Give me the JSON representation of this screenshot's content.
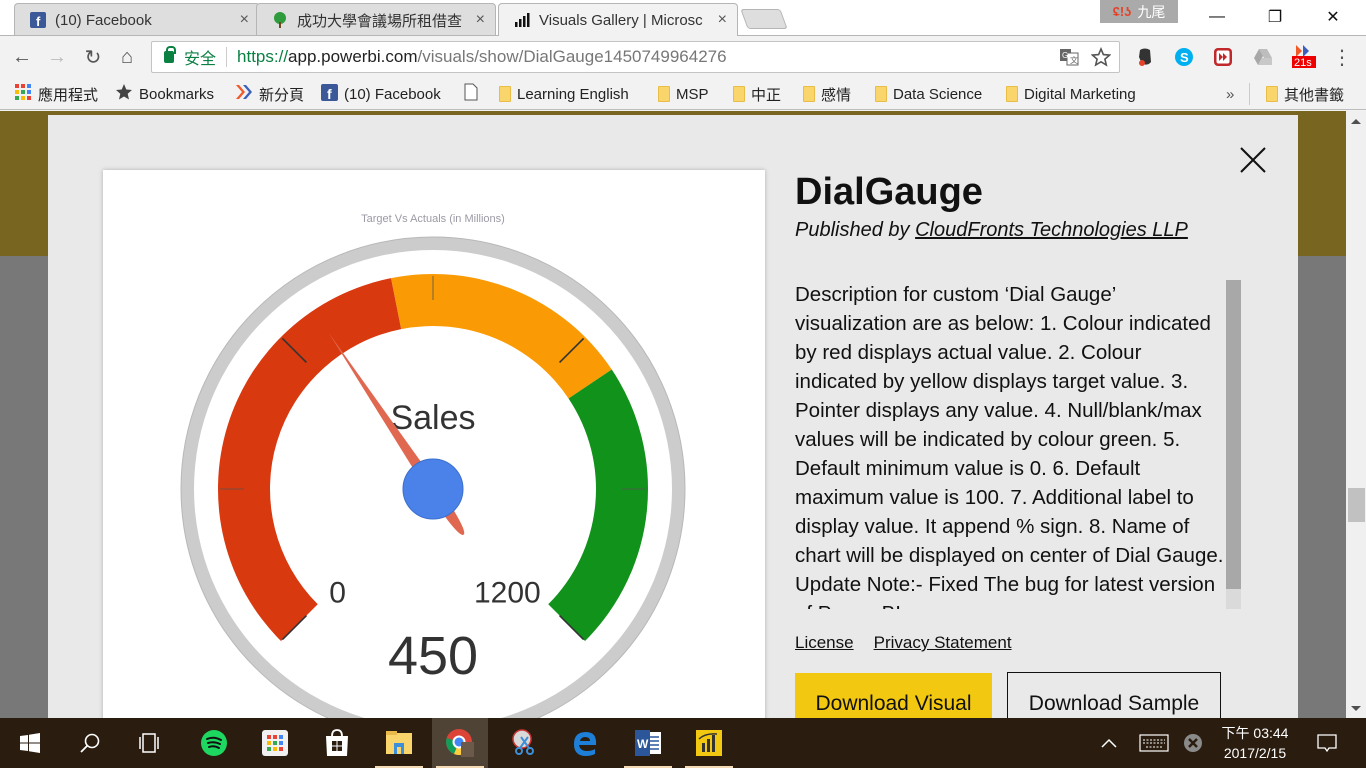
{
  "browser": {
    "tabs": [
      {
        "title": "(10) Facebook",
        "icon": "facebook-icon",
        "active": false
      },
      {
        "title": "成功大學會議場所租借查",
        "icon": "tree-icon",
        "active": false
      },
      {
        "title": "Visuals Gallery | Microsc",
        "icon": "powerbi-bars-icon",
        "active": true
      }
    ],
    "tab_close_glyph": "×",
    "profile_name": "九尾",
    "profile_sync_glyph": "ʢ!ʖ",
    "window_controls": {
      "minimize": "—",
      "restore": "❐",
      "close": "✕"
    },
    "nav": {
      "back": "←",
      "forward": "→",
      "reload": "↻",
      "home": "⌂"
    },
    "omnibox": {
      "secure_label": "安全",
      "url_scheme": "https://",
      "url_host": "app.powerbi.com",
      "url_path": "/visuals/show/DialGauge1450749964276"
    },
    "extensions": [
      {
        "name": "evernote-icon"
      },
      {
        "name": "skype-icon"
      },
      {
        "name": "video-speed-icon"
      },
      {
        "name": "google-drive-icon"
      },
      {
        "name": "timer-extension-icon",
        "badge": "21s"
      }
    ],
    "menu_glyph": "⋮",
    "bookmarks": [
      {
        "label": "應用程式",
        "icon": "apps-grid-icon"
      },
      {
        "label": "Bookmarks",
        "icon": "star-icon"
      },
      {
        "label": "新分頁",
        "icon": "double-chevron-icon"
      },
      {
        "label": "(10) Facebook",
        "icon": "facebook-icon"
      },
      {
        "label": "",
        "icon": "page-icon"
      },
      {
        "label": "Learning English",
        "icon": "folder-icon"
      },
      {
        "label": "MSP",
        "icon": "folder-icon"
      },
      {
        "label": "中正",
        "icon": "folder-icon"
      },
      {
        "label": "感情",
        "icon": "folder-icon"
      },
      {
        "label": "Data Science",
        "icon": "folder-icon"
      },
      {
        "label": "Digital Marketing",
        "icon": "folder-icon"
      }
    ],
    "bookmarks_overflow": "»",
    "other_bookmarks": "其他書籤"
  },
  "visual": {
    "title": "DialGauge",
    "published_by_label": "Published by",
    "publisher": "CloudFronts Technologies LLP",
    "description": "Description for custom ‘Dial Gauge’ visualization are as below: 1. Colour indicated by red displays actual value. 2. Colour indicated by yellow displays target value. 3. Pointer displays any value. 4. Null/blank/max values will be indicated by colour green. 5. Default minimum value is 0. 6. Default maximum value is 100. 7. Additional label to display value. It append % sign. 8. Name of chart will be displayed on center of Dial Gauge. Update Note:- Fixed The bug for latest version of Power BI",
    "description_scroll_fraction": 0.94,
    "links": [
      "License",
      "Privacy Statement"
    ],
    "download_visual": "Download Visual",
    "download_sample": "Download Sample",
    "close_glyph": "✕"
  },
  "chart_data": {
    "type": "gauge",
    "title": "Target Vs Actuals (in Millions)",
    "center_label": "Sales",
    "min": 0,
    "max": 1200,
    "min_label": "0",
    "max_label": "1200",
    "value": 450,
    "value_label": "450",
    "bands": [
      {
        "name": "actual",
        "from": 0,
        "to": 550,
        "color": "#d9390f"
      },
      {
        "name": "target",
        "from": 550,
        "to": 850,
        "color": "#fa9a04"
      },
      {
        "name": "max",
        "from": 850,
        "to": 1200,
        "color": "#10921b"
      }
    ],
    "major_ticks": [
      0,
      400,
      800,
      1200
    ],
    "minor_ticks": [
      200,
      600,
      1000
    ],
    "colors": {
      "ring": "#cccccc",
      "needle": "#e06850",
      "hub": "#4a82ea",
      "text": "#333333",
      "title": "#9a9aa5"
    }
  },
  "page": {
    "banner_color": "#786620",
    "overlay_color": "#787878",
    "accent_button": "#f2c811"
  },
  "taskbar": {
    "apps": [
      {
        "name": "start-icon"
      },
      {
        "name": "search-icon"
      },
      {
        "name": "task-view-icon"
      },
      {
        "name": "spotify-icon"
      },
      {
        "name": "app-launcher-icon"
      },
      {
        "name": "store-icon"
      },
      {
        "name": "file-explorer-icon"
      },
      {
        "name": "chrome-icon"
      },
      {
        "name": "snipping-tool-icon"
      },
      {
        "name": "edge-icon"
      },
      {
        "name": "word-icon"
      },
      {
        "name": "powerbi-icon"
      }
    ],
    "time": "下午 03:44",
    "date": "2017/2/15"
  }
}
